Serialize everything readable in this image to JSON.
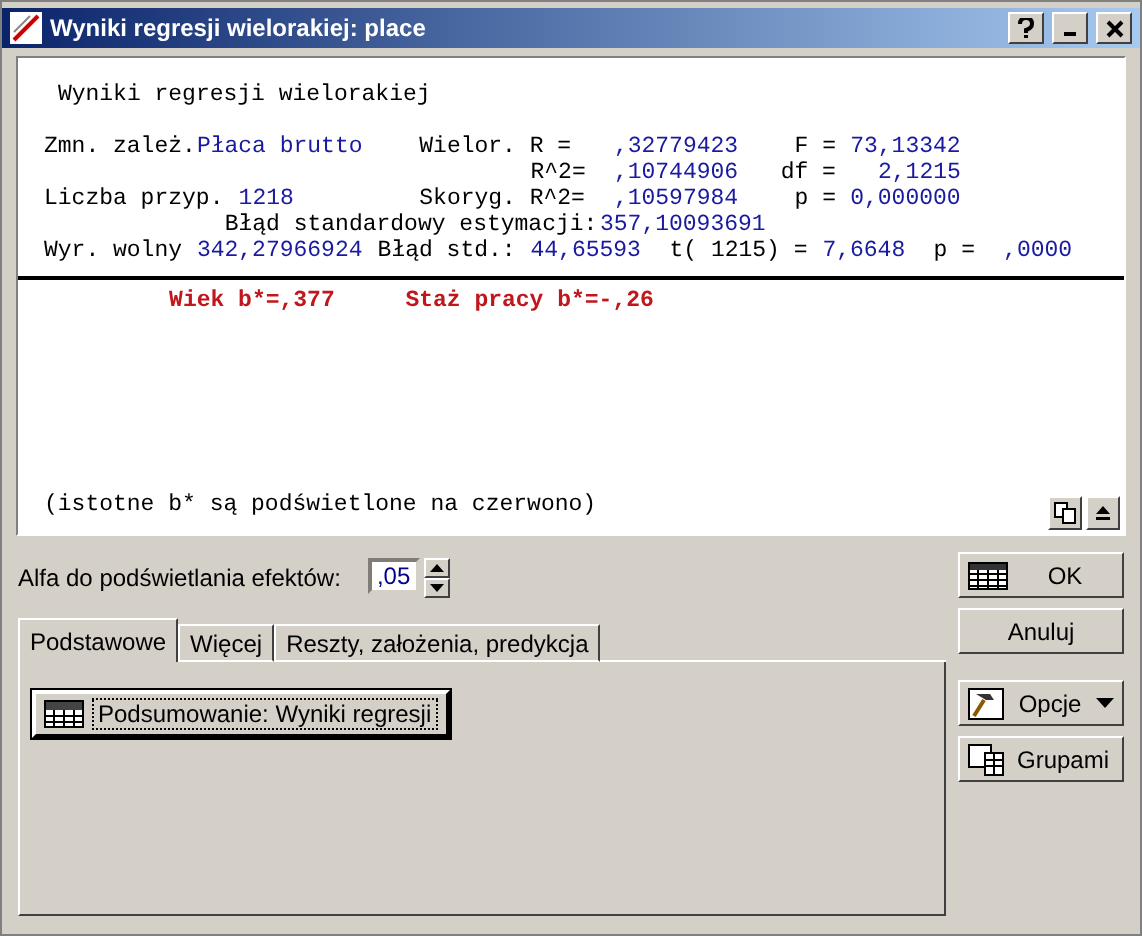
{
  "window": {
    "title": "Wyniki regresji wielorakiej: place"
  },
  "output": {
    "heading": "Wyniki regresji wielorakiej",
    "lines": [
      [
        {
          "text": "Zmn. zależ.",
          "kind": "label"
        },
        {
          "text": "Płaca brutto",
          "kind": "value"
        },
        {
          "text": "Wielor. R =",
          "kind": "label"
        },
        {
          "text": ",32779423",
          "kind": "value"
        },
        {
          "text": "F =",
          "kind": "label"
        },
        {
          "text": "73,13342",
          "kind": "value"
        }
      ],
      [
        {
          "text": "R^2=",
          "kind": "label"
        },
        {
          "text": ",10744906",
          "kind": "value"
        },
        {
          "text": "df =",
          "kind": "label"
        },
        {
          "text": "2,1215",
          "kind": "value"
        }
      ],
      [
        {
          "text": "Liczba przyp.",
          "kind": "label"
        },
        {
          "text": "1218",
          "kind": "value"
        },
        {
          "text": "Skoryg. R^2=",
          "kind": "label"
        },
        {
          "text": ",10597984",
          "kind": "value"
        },
        {
          "text": "p =",
          "kind": "label"
        },
        {
          "text": "0,000000",
          "kind": "value"
        }
      ],
      [
        {
          "text": "Błąd standardowy estymacji:",
          "kind": "label"
        },
        {
          "text": "357,10093691",
          "kind": "value"
        }
      ],
      [
        {
          "text": "Wyr. wolny",
          "kind": "label"
        },
        {
          "text": "342,27966924",
          "kind": "value"
        },
        {
          "text": "Błąd std.:",
          "kind": "label"
        },
        {
          "text": "44,65593",
          "kind": "value"
        },
        {
          "text": "t( 1215) =",
          "kind": "label"
        },
        {
          "text": "7,6648",
          "kind": "value"
        },
        {
          "text": "p =",
          "kind": "label"
        },
        {
          "text": ",0000",
          "kind": "value"
        }
      ]
    ],
    "effects": [
      {
        "text": "Wiek b*=,377",
        "kind": "effect"
      },
      {
        "text": "Staż pracy b*=-,26",
        "kind": "effect"
      }
    ],
    "note": "(istotne b* są podświetlone na czerwono)"
  },
  "alpha": {
    "label": "Alfa do podświetlania efektów:",
    "value": ",05"
  },
  "tabs": [
    {
      "label": "Podstawowe",
      "selected": true
    },
    {
      "label": "Więcej",
      "selected": false
    },
    {
      "label": "Reszty, założenia, predykcja",
      "selected": false
    }
  ],
  "summary_button": "Podsumowanie:  Wyniki regresji",
  "buttons": [
    {
      "label": "OK",
      "kind": "table"
    },
    {
      "label": "Anuluj",
      "kind": "plain"
    },
    {
      "label": "Opcje",
      "kind": "menu"
    },
    {
      "label": "Grupami",
      "kind": "groups"
    }
  ]
}
